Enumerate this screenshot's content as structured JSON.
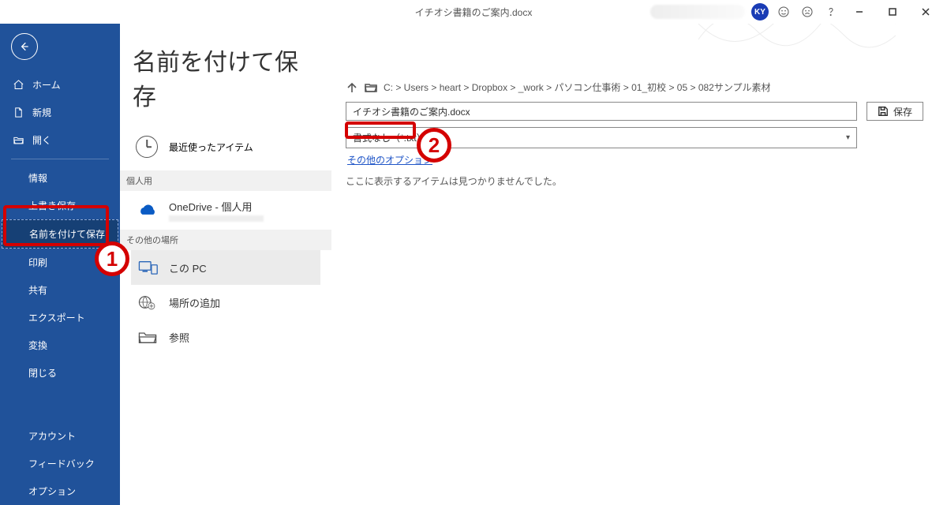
{
  "titlebar": {
    "document_title": "イチオシ書籍のご案内.docx",
    "user_initials": "KY"
  },
  "sidebar": {
    "home": "ホーム",
    "new": "新規",
    "open": "開く",
    "info": "情報",
    "save": "上書き保存",
    "saveas": "名前を付けて保存",
    "print": "印刷",
    "share": "共有",
    "export": "エクスポート",
    "transform": "変換",
    "close": "閉じる",
    "account": "アカウント",
    "feedback": "フィードバック",
    "options": "オプション"
  },
  "page": {
    "title": "名前を付けて保存",
    "recent_label": "最近使ったアイテム",
    "section_personal": "個人用",
    "onedrive_label": "OneDrive - 個人用",
    "section_other": "その他の場所",
    "this_pc": "この PC",
    "add_place": "場所の追加",
    "browse": "参照"
  },
  "mainpanel": {
    "breadcrumb": "C: > Users > heart > Dropbox > _work > パソコン仕事術 > 01_初校 > 05 > 082サンプル素材",
    "filename": "イチオシ書籍のご案内.docx",
    "filetype_truncated": "書式なし（*.txt）",
    "save_button": "保存",
    "more_options": "その他のオプション",
    "empty_msg": "ここに表示するアイテムは見つかりませんでした。"
  },
  "callouts": {
    "c1": "1",
    "c2": "2"
  }
}
